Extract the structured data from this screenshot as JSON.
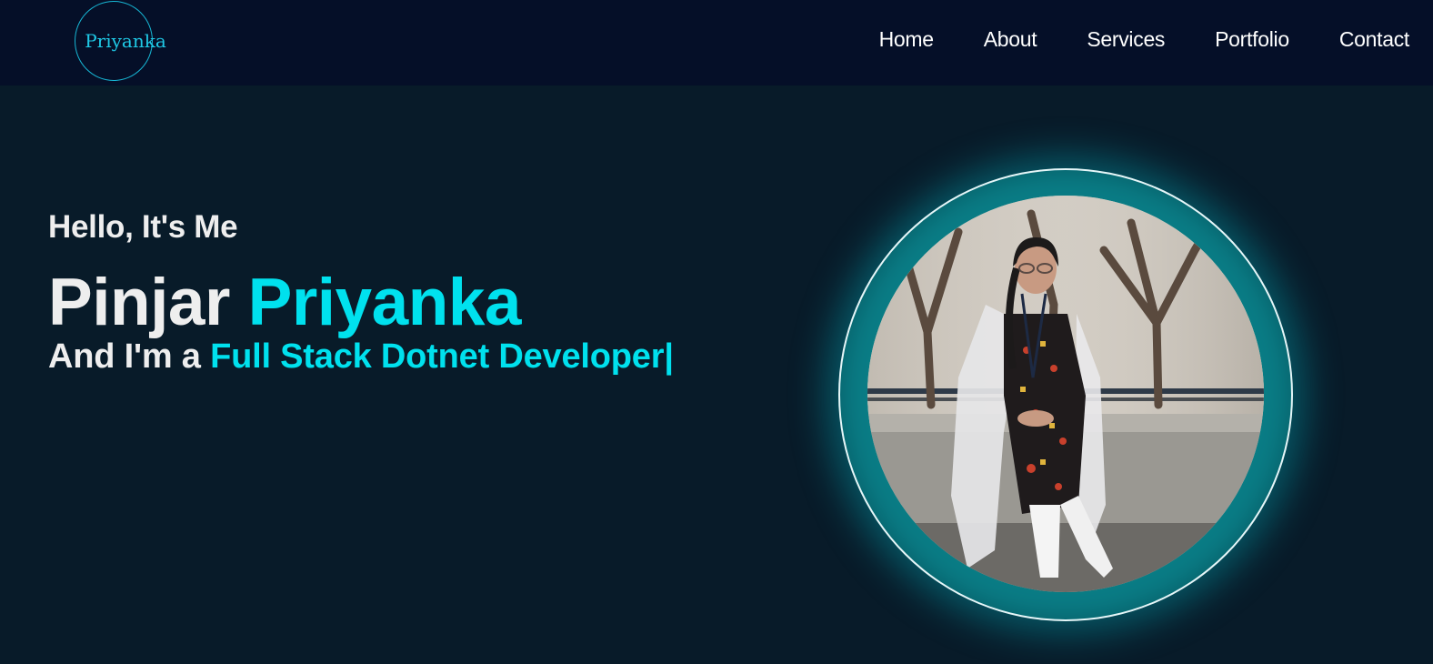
{
  "nav": {
    "logo": "Priyanka",
    "links": [
      {
        "label": "Home"
      },
      {
        "label": "About"
      },
      {
        "label": "Services"
      },
      {
        "label": "Portfolio"
      },
      {
        "label": "Contact"
      }
    ]
  },
  "hero": {
    "greeting": "Hello, It's Me",
    "first_name": "Pinjar",
    "last_name": "Priyanka",
    "role_prefix": "And I'm a",
    "role_title": "Full Stack Dotnet Developer",
    "cursor": "|"
  },
  "colors": {
    "background": "#081b29",
    "navbar": "#050f28",
    "accent": "#00e1ee",
    "text": "#eeeeee"
  },
  "icons": {
    "profile": "profile-photo"
  }
}
